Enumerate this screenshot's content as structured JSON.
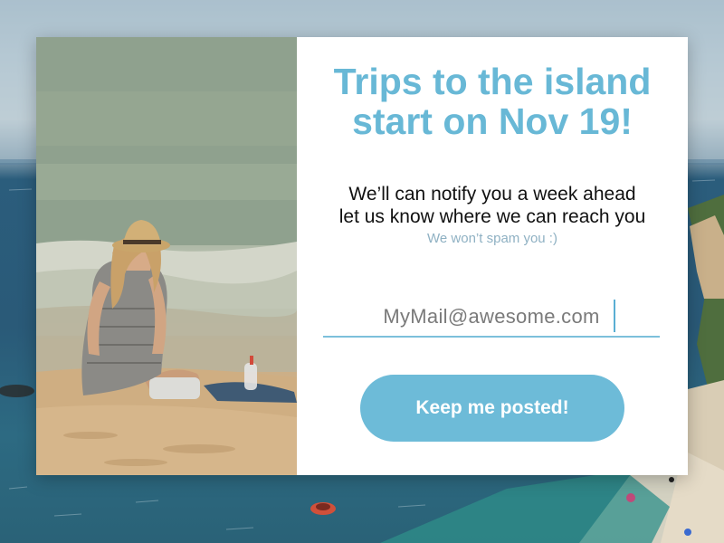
{
  "modal": {
    "headline_line1": "Trips to the island",
    "headline_line2": "start on Nov 19!",
    "subtext_line1": "We’ll can notify you a week ahead",
    "subtext_line2": "let us know where we can reach you",
    "note": "We won’t spam you :)",
    "email": {
      "value": "MyMail@awesome.com"
    },
    "cta_label": "Keep me posted!"
  },
  "colors": {
    "accent": "#6dbbd8",
    "headline": "#68b8d6",
    "note": "#8fb1c3"
  }
}
